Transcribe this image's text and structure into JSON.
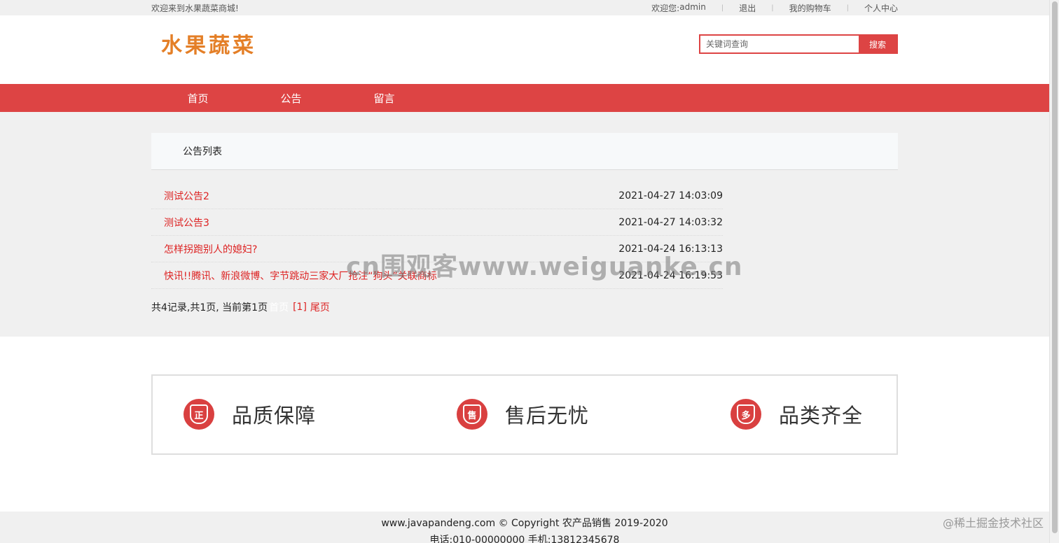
{
  "topbar": {
    "welcome": "欢迎来到水果蔬菜商城!",
    "user_prefix": "欢迎您:",
    "username": "admin",
    "logout": "退出",
    "cart": "我的购物车",
    "profile": "个人中心",
    "separator": "|"
  },
  "header": {
    "logo": "水果蔬菜",
    "search_placeholder": "关键词查询",
    "search_button": "搜索"
  },
  "nav": {
    "items": [
      {
        "label": "首页"
      },
      {
        "label": "公告"
      },
      {
        "label": "留言"
      }
    ]
  },
  "notice": {
    "heading": "公告列表",
    "items": [
      {
        "title": "测试公告2",
        "time": "2021-04-27 14:03:09"
      },
      {
        "title": "测试公告3",
        "time": "2021-04-27 14:03:32"
      },
      {
        "title": "怎样拐跑别人的媳妇?",
        "time": "2021-04-24 16:13:13"
      },
      {
        "title": "快讯!!腾讯、新浪微博、字节跳动三家大厂抢注“狗头”关联商标",
        "time": "2021-04-24 16:19:53"
      }
    ],
    "pager": {
      "summary": "共4记录,共1页, 当前第1页",
      "first": "首页",
      "page": "[1]",
      "last": "尾页"
    }
  },
  "features": [
    {
      "icon": "certified-shield-icon",
      "badge": "正",
      "label": "品质保障"
    },
    {
      "icon": "after-sale-shield-icon",
      "badge": "售",
      "label": "售后无忧"
    },
    {
      "icon": "variety-shield-icon",
      "badge": "多",
      "label": "品类齐全"
    }
  ],
  "footer": {
    "line1": "www.javapandeng.com © Copyright 农产品销售 2019-2020",
    "line2": "电话:010-00000000 手机:13812345678"
  },
  "watermark": {
    "center": "cn围观客www.weiguanke.cn",
    "corner": "@稀土掘金技术社区"
  },
  "colors": {
    "accent": "#dd4444",
    "logo": "#e47f27",
    "link": "#dd2222"
  }
}
